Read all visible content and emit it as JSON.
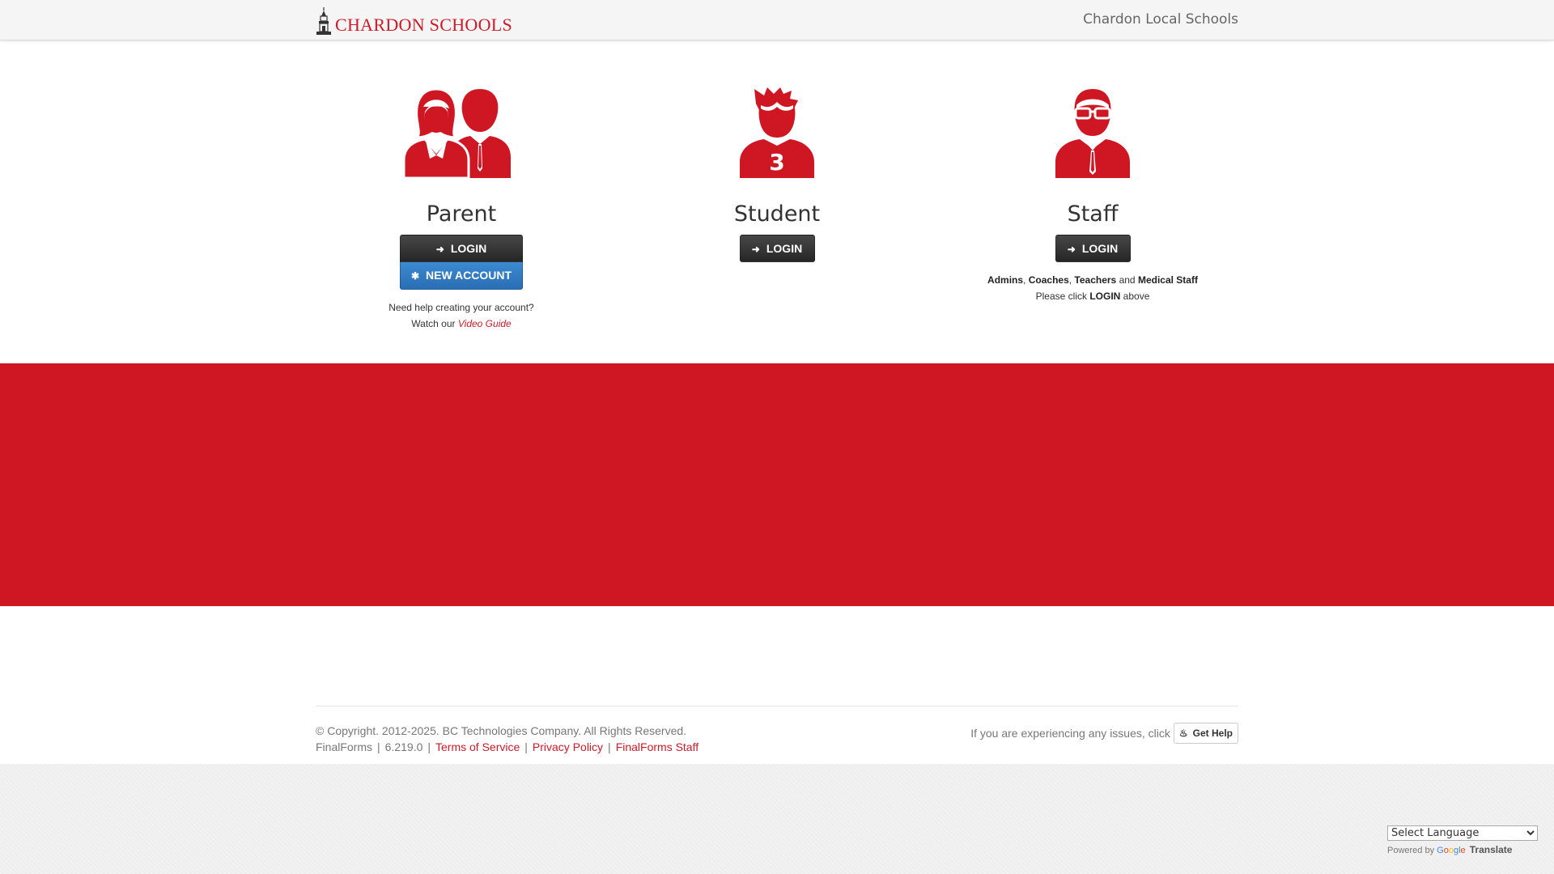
{
  "header": {
    "brand_text": "CHARDON SCHOOLS",
    "district_name": "Chardon Local Schools"
  },
  "roles": {
    "parent": {
      "title": "Parent",
      "login_label": "LOGIN",
      "new_account_label": "NEW ACCOUNT",
      "help_line1": "Need help creating your account?",
      "help_line2_prefix": "Watch our",
      "video_guide_link": "Video Guide"
    },
    "student": {
      "title": "Student",
      "login_label": "LOGIN",
      "jersey_number": "3"
    },
    "staff": {
      "title": "Staff",
      "login_label": "LOGIN",
      "note_admins": "Admins",
      "note_coaches": "Coaches",
      "note_teachers": "Teachers",
      "note_and": "and",
      "note_medical": "Medical Staff",
      "note_please": "Please click",
      "note_login": "LOGIN",
      "note_above": "above"
    }
  },
  "footer": {
    "copyright": "© Copyright. 2012-2025. BC Technologies Company. All Rights Reserved.",
    "product": "FinalForms",
    "version": "6.219.0",
    "links": [
      "Terms of Service",
      "Privacy Policy",
      "FinalForms Staff"
    ],
    "issues_text": "If you are experiencing any issues, click",
    "get_help_label": "Get Help"
  },
  "translate": {
    "select_label": "Select Language",
    "powered_by": "Powered by",
    "translate_word": "Translate"
  },
  "colors": {
    "brand_red": "#cf1724",
    "button_dark": "#333333",
    "button_blue": "#337ab7"
  }
}
